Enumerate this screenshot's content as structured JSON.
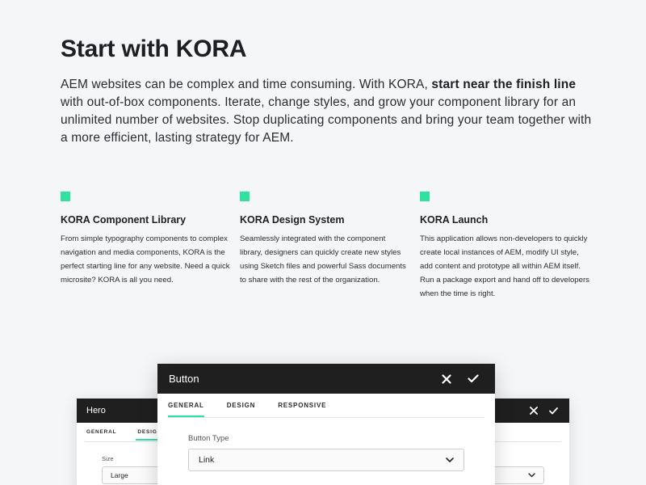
{
  "headline": "Start with KORA",
  "intro": {
    "part1": "AEM websites can be complex and time consuming. With KORA, ",
    "bold": "start near the finish line",
    "part2": " with out-of-box components. Iterate, change styles, and grow your component library for an unlimited number of websites. Stop duplicating components and bring your team together with a more efficient, lasting strategy for AEM."
  },
  "features": [
    {
      "title": "KORA Component Library",
      "text": "From simple typography components to complex navigation and media components, KORA is the perfect starting line for any website. Need a quick microsite? KORA is all you need."
    },
    {
      "title": "KORA Design System",
      "text": "Seamlessly integrated with the component library, designers can quickly create new styles using Sketch files and powerful Sass documents to share with the rest of the organization."
    },
    {
      "title": "KORA Launch",
      "text": "This application allows non-developers to quickly create local instances of AEM, modify UI style, add content and prototype all within AEM itself. Run a package export and hand off to developers when the time is right."
    }
  ],
  "accent_color": "#2ee3a0",
  "mockups": {
    "hero": {
      "title": "Hero",
      "tabs": [
        "GENERAL",
        "DESIGN"
      ],
      "active_tab": "DESIGN",
      "field_label": "Size",
      "field_value": "Large"
    },
    "button": {
      "title": "Button",
      "tabs": [
        "GENERAL",
        "DESIGN",
        "RESPONSIVE"
      ],
      "active_tab": "GENERAL",
      "field_label": "Button Type",
      "field_value": "Link"
    }
  }
}
